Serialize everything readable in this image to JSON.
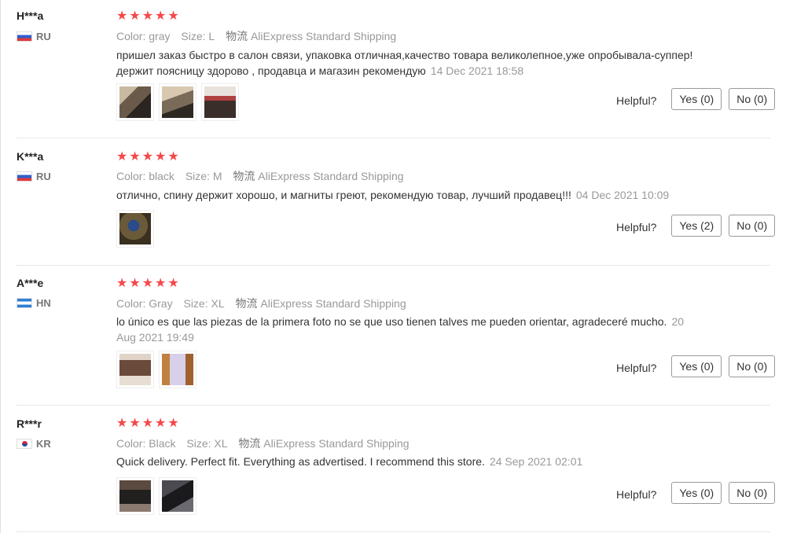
{
  "labels": {
    "color": "Color:",
    "size": "Size:",
    "shipping": "物流",
    "helpful": "Helpful?"
  },
  "reviews": [
    {
      "user": "H***a",
      "country": "RU",
      "rating": 5,
      "color": "gray",
      "size": "L",
      "shipping": "AliExpress Standard Shipping",
      "text": "пришел заказ быстро в салон связи, упаковка отличная,качество товара великолепное,уже опробывала-суппер! держит поясницу здорово , продавца и магазин рекомендую",
      "date": "14 Dec 2021 18:58",
      "images": [
        "photo-1",
        "photo-2",
        "photo-3"
      ],
      "yes": "Yes (0)",
      "no": "No (0)"
    },
    {
      "user": "K***a",
      "country": "RU",
      "rating": 5,
      "color": "black",
      "size": "M",
      "shipping": "AliExpress Standard Shipping",
      "text": "отлично, спину держит хорошо, и магниты греют, рекомендую товар, лучший продавец!!!",
      "date": "04 Dec 2021 10:09",
      "images": [
        "photo-1"
      ],
      "yes": "Yes (2)",
      "no": "No (0)"
    },
    {
      "user": "A***e",
      "country": "HN",
      "rating": 5,
      "color": "Gray",
      "size": "XL",
      "shipping": "AliExpress Standard Shipping",
      "text": "lo único es que las piezas de la primera foto no se que uso tienen talves me pueden orientar, agradeceré mucho.",
      "date": "20 Aug 2021 19:49",
      "images": [
        "photo-1",
        "photo-2"
      ],
      "yes": "Yes (0)",
      "no": "No (0)"
    },
    {
      "user": "R***r",
      "country": "KR",
      "rating": 5,
      "color": "Black",
      "size": "XL",
      "shipping": "AliExpress Standard Shipping",
      "text": "Quick delivery. Perfect fit. Everything as advertised. I recommend this store.",
      "date": "24 Sep 2021 02:01",
      "images": [
        "photo-1",
        "photo-2"
      ],
      "yes": "Yes (0)",
      "no": "No (0)"
    }
  ]
}
